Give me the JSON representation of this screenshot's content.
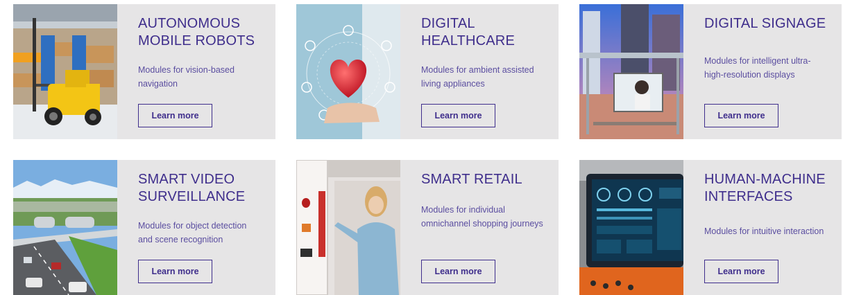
{
  "cards": [
    {
      "title": "Autonomous Mobile Robots",
      "description": "Modules for vision-based navigation",
      "button_label": "Learn more",
      "image": "forklift-in-warehouse"
    },
    {
      "title": "Digital Healthcare",
      "description": "Modules for ambient assisted living appliances",
      "button_label": "Learn more",
      "image": "hand-holding-heart-with-health-icons"
    },
    {
      "title": "Digital Signage",
      "description": "Modules for intelligent ultra-high-resolution displays",
      "button_label": "Learn more",
      "image": "bus-stop-billboard-in-city"
    },
    {
      "title": "Smart Video Surveillance",
      "description": "Modules for object detection and scene recognition",
      "button_label": "Learn more",
      "image": "highway-with-cars-and-mountains"
    },
    {
      "title": "Smart Retail",
      "description": "Modules for individual omnichannel shopping journeys",
      "button_label": "Learn more",
      "image": "woman-using-retail-kiosk"
    },
    {
      "title": "Human-Machine Interfaces",
      "description": "Modules for intuitive interaction",
      "button_label": "Learn more",
      "image": "industrial-control-panel-touchscreen"
    }
  ],
  "colors": {
    "card_background": "#e6e5e6",
    "title": "#3f2e8c",
    "text": "#5b4ea0",
    "button_border": "#3f2e8c"
  }
}
